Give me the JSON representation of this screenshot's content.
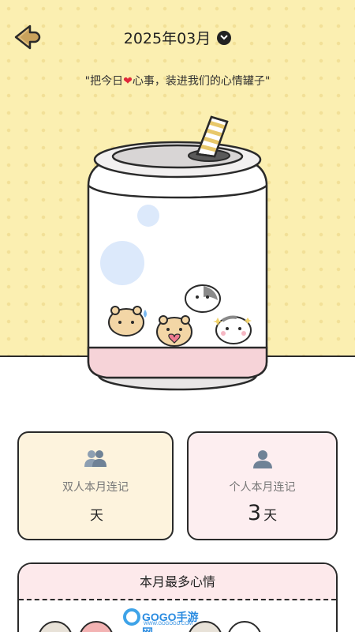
{
  "header": {
    "month": "2025年03月",
    "subtitle_pre": "\"把今日",
    "subtitle_heart": "❤",
    "subtitle_post": "心事，装进我们的心情罐子\""
  },
  "icons": {
    "back": "back-arrow-icon",
    "chevron": "chevron-down-icon",
    "couple": "couple-icon",
    "person": "person-icon"
  },
  "stats": {
    "couple": {
      "label": "双人本月连记",
      "value": "",
      "unit": "天"
    },
    "personal": {
      "label": "个人本月连记",
      "value": "3",
      "unit": "天"
    }
  },
  "mood": {
    "title": "本月最多心情"
  },
  "watermark": {
    "text": "GOGO手游网",
    "sub": "WWW.GOGOGO.COM"
  },
  "colors": {
    "header_bg": "#fbefb1",
    "card_couple_bg": "#fdf3dd",
    "card_personal_bg": "#fdeef0",
    "mood_head_bg": "#fde9eb",
    "can_stripe": "#f6d3d8"
  }
}
